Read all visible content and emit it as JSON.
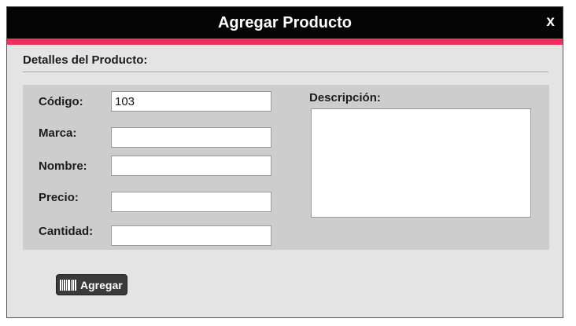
{
  "dialog": {
    "title": "Agregar Producto",
    "close_label": "x"
  },
  "section": {
    "heading": "Detalles del Producto:"
  },
  "fields": {
    "codigo": {
      "label": "Código:",
      "value": "103"
    },
    "marca": {
      "label": "Marca:",
      "value": ""
    },
    "nombre": {
      "label": "Nombre:",
      "value": ""
    },
    "precio": {
      "label": "Precio:",
      "value": ""
    },
    "cantidad": {
      "label": "Cantidad:",
      "value": ""
    },
    "descripcion": {
      "label": "Descripción:",
      "value": ""
    }
  },
  "actions": {
    "add_label": "Agregar",
    "add_icon": "barcode-icon"
  },
  "colors": {
    "titlebar": "#050505",
    "accent": "#ee2f5e",
    "dialog_bg": "#e4e4e4",
    "panel_bg": "#cdcdcd",
    "button_bg": "#3a3a3a"
  }
}
